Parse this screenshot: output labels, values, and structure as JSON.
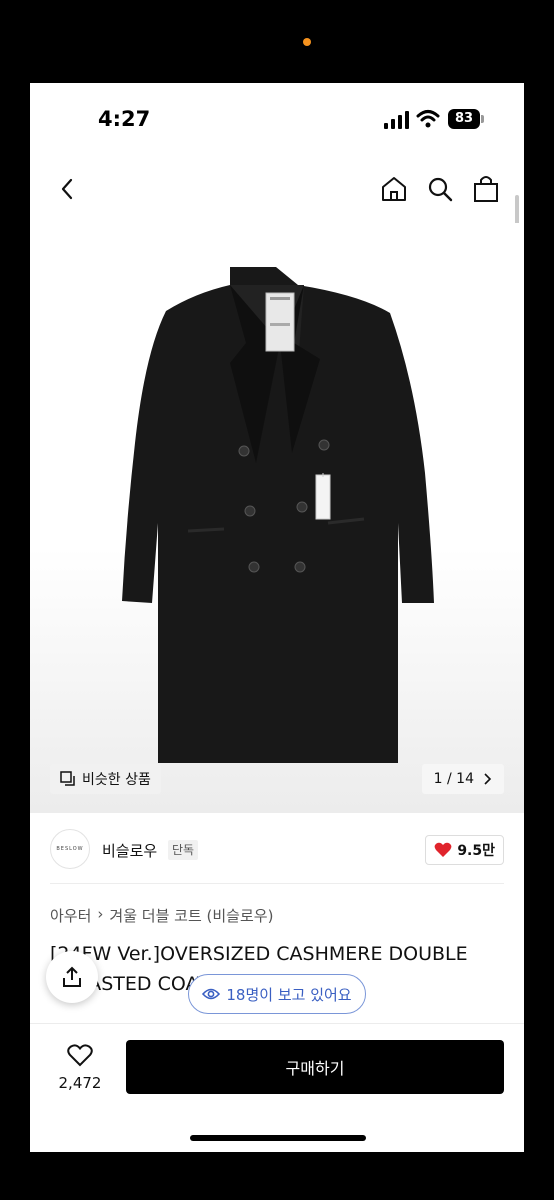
{
  "status_bar": {
    "time": "4:27",
    "battery": "83"
  },
  "gallery": {
    "similar_label": "비슷한 상품",
    "pager": "1 / 14"
  },
  "brand": {
    "logo_text": "BESLOW",
    "name": "비슬로우",
    "tag": "단독",
    "likes": "9.5만"
  },
  "breadcrumb": {
    "category": "아우터",
    "subcategory": "겨울 더블 코트 (비슬로우)"
  },
  "product": {
    "title": "[24FW Ver.]OVERSIZED CASHMERE DOUBLE BREASTED COAT"
  },
  "viewers": {
    "label": "18명이 보고 있어요"
  },
  "bottom_bar": {
    "wishlist_count": "2,472",
    "buy_label": "구매하기"
  },
  "colors": {
    "accent_blue": "#3a5fc2",
    "heart_red": "#e0242c",
    "button_black": "#000000"
  }
}
